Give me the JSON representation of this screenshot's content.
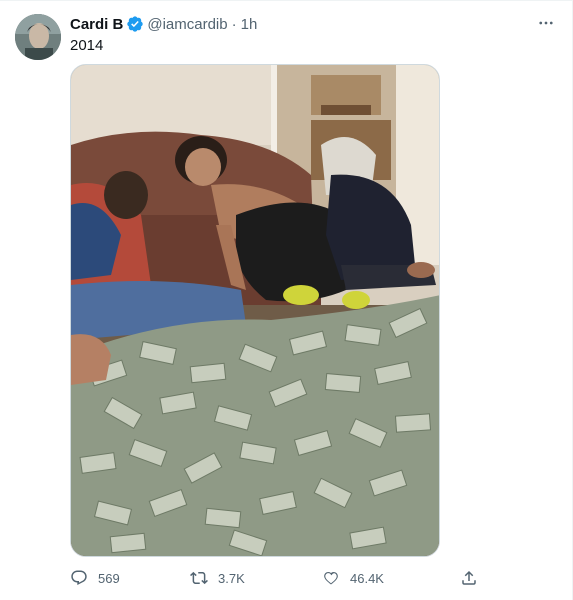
{
  "tweet": {
    "author": {
      "display_name": "Cardi B",
      "handle": "@iamcardib",
      "verified": true,
      "avatar": "profile-photo"
    },
    "separator": "·",
    "time": "1h",
    "text": "2014",
    "media": {
      "alt": "photo"
    },
    "actions": {
      "reply_count": "569",
      "retweet_count": "3.7K",
      "like_count": "46.4K"
    },
    "icons": {
      "more": "more-horizontal-icon",
      "verified": "verified-badge-icon",
      "reply": "reply-icon",
      "retweet": "retweet-icon",
      "like": "heart-icon",
      "share": "share-icon"
    },
    "colors": {
      "verified": "#1d9bf0",
      "secondary_text": "#536471",
      "primary_text": "#0f1419"
    }
  }
}
